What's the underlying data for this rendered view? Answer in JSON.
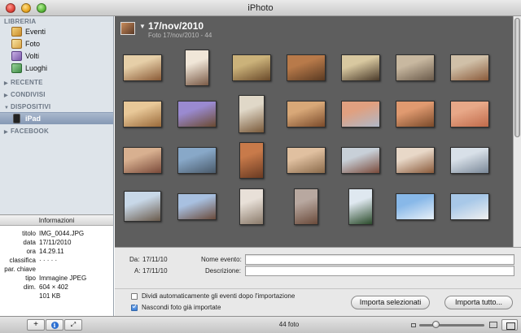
{
  "window": {
    "title": "iPhoto"
  },
  "sidebar": {
    "library_header": "LIBRERIA",
    "library_items": [
      {
        "label": "Eventi",
        "icon": "events-icon"
      },
      {
        "label": "Foto",
        "icon": "photos-icon"
      },
      {
        "label": "Volti",
        "icon": "faces-icon"
      },
      {
        "label": "Luoghi",
        "icon": "places-icon"
      }
    ],
    "recent_header": "RECENTE",
    "shared_header": "CONDIVISI",
    "devices_header": "DISPOSITIVI",
    "device_item": "iPad",
    "facebook_header": "FACEBOOK"
  },
  "info": {
    "header": "Informazioni",
    "rows": [
      {
        "key": "titolo",
        "value": "IMG_0044.JPG"
      },
      {
        "key": "data",
        "value": "17/11/2010"
      },
      {
        "key": "ora",
        "value": "14.29.11"
      },
      {
        "key": "classifica",
        "value": "· · · · ·"
      },
      {
        "key": "par. chiave",
        "value": ""
      },
      {
        "key": "tipo",
        "value": "Immagine JPEG"
      },
      {
        "key": "dim.",
        "value": "604 × 402"
      },
      {
        "key": "",
        "value": "101 KB"
      }
    ]
  },
  "event": {
    "title": "17/nov/2010",
    "subtitle": "Foto 17/nov/2010 - 44"
  },
  "form": {
    "from_label": "Da:",
    "from_value": "17/11/10",
    "to_label": "A:",
    "to_value": "17/11/10",
    "name_label": "Nome evento:",
    "name_value": "",
    "desc_label": "Descrizione:",
    "desc_value": ""
  },
  "import": {
    "split_label": "Dividi automaticamente gli eventi dopo l'importazione",
    "split_checked": false,
    "hide_label": "Nascondi foto già importate",
    "hide_checked": true,
    "import_selected": "Importa selezionati",
    "import_all": "Importa tutto..."
  },
  "toolbar": {
    "add_label": "+",
    "info_label": "i",
    "fullscreen_label": "⤢",
    "photo_count": "44 foto",
    "zoom_level": 0.25
  },
  "grid": {
    "photos": [
      {
        "c1": "#e6cfa8",
        "c2": "#8a5a36"
      },
      {
        "c1": "#f0e6d8",
        "c2": "#7a5a46"
      },
      {
        "c1": "#cbb27a",
        "c2": "#6a4a2a"
      },
      {
        "c1": "#b87a4a",
        "c2": "#5a3a22"
      },
      {
        "c1": "#d8c8a0",
        "c2": "#4a3a2a"
      },
      {
        "c1": "#c8b8a0",
        "c2": "#6a5a4a"
      },
      {
        "c1": "#d0c0a8",
        "c2": "#8a5a3a"
      },
      {
        "c1": "#e8c898",
        "c2": "#9a6a3a"
      },
      {
        "c1": "#9a8ad0",
        "c2": "#6a4a30"
      },
      {
        "c1": "#e0d8c8",
        "c2": "#7a5a3a"
      },
      {
        "c1": "#d8a878",
        "c2": "#7a4a2a"
      },
      {
        "c1": "#e0a080",
        "c2": "#b0b8c8"
      },
      {
        "c1": "#e09a70",
        "c2": "#7a4a2a"
      },
      {
        "c1": "#e8a888",
        "c2": "#c06a4a"
      },
      {
        "c1": "#d8b090",
        "c2": "#7a4a3a"
      },
      {
        "c1": "#88a8c8",
        "c2": "#4a5a6a"
      },
      {
        "c1": "#c87a4a",
        "c2": "#6a3a22"
      },
      {
        "c1": "#e0c0a0",
        "c2": "#8a6a4a"
      },
      {
        "c1": "#c8d0d8",
        "c2": "#7a4a3a"
      },
      {
        "c1": "#e8d8c8",
        "c2": "#8a5a3a"
      },
      {
        "c1": "#d8e0e8",
        "c2": "#7a8898"
      },
      {
        "c1": "#c8d8e8",
        "c2": "#6a5a4a"
      },
      {
        "c1": "#a8c0e0",
        "c2": "#6a4a3a"
      },
      {
        "c1": "#e8e0d8",
        "c2": "#8a7a6a"
      },
      {
        "c1": "#b8a8a0",
        "c2": "#6a4a3a"
      },
      {
        "c1": "#dfe8f0",
        "c2": "#2a4a2a"
      },
      {
        "c1": "#88b8e8",
        "c2": "#e8f0f8"
      },
      {
        "c1": "#a8c8e8",
        "c2": "#f0f0f0"
      }
    ]
  },
  "colors": {
    "selection": "#8598b4",
    "canvas": "#5e5e5e"
  }
}
